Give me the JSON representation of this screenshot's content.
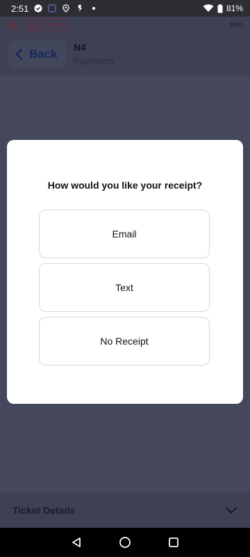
{
  "status_bar": {
    "time": "2:51",
    "battery": "81%",
    "icons": [
      "check-circle-icon",
      "app-icon",
      "location-icon",
      "flashlight-icon",
      "dot-icon",
      "wifi-icon",
      "battery-icon"
    ]
  },
  "app_bar": {
    "issue_label": "1 Issue",
    "brand": "iMin"
  },
  "header": {
    "back_label": "Back",
    "title": "N4",
    "subtitle": "Payments"
  },
  "modal": {
    "title": "How would you like your receipt?",
    "options": [
      {
        "label": "Email"
      },
      {
        "label": "Text"
      },
      {
        "label": "No Receipt"
      }
    ]
  },
  "footer": {
    "label": "Ticket Details"
  },
  "colors": {
    "overlay": "#45485c",
    "accent": "#15285c",
    "issue": "#6a2d36"
  }
}
